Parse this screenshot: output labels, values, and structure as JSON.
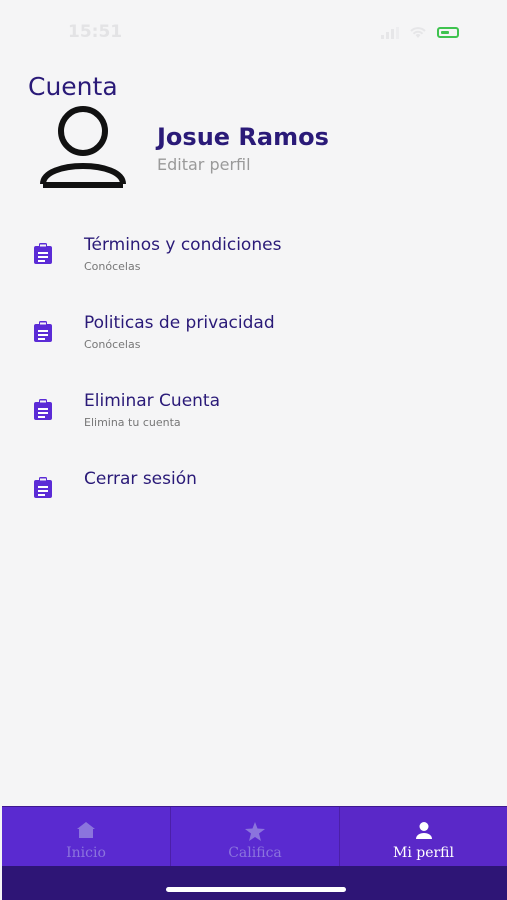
{
  "status_bar": {
    "time": "15:51"
  },
  "page": {
    "title": "Cuenta"
  },
  "profile": {
    "name": "Josue Ramos",
    "edit_label": "Editar perfil"
  },
  "menu": [
    {
      "title": "Términos y condiciones",
      "subtitle": "Conócelas",
      "icon": "clipboard-icon"
    },
    {
      "title": "Politicas de privacidad",
      "subtitle": "Conócelas",
      "icon": "clipboard-icon"
    },
    {
      "title": "Eliminar Cuenta",
      "subtitle": "Elimina tu cuenta",
      "icon": "clipboard-icon"
    },
    {
      "title": "Cerrar sesión",
      "subtitle": "",
      "icon": "clipboard-icon"
    }
  ],
  "bottom_nav": {
    "items": [
      {
        "label": "Inicio",
        "icon": "home-icon",
        "active": false
      },
      {
        "label": "Califica",
        "icon": "star-icon",
        "active": false
      },
      {
        "label": "Mi perfil",
        "icon": "person-icon",
        "active": true
      }
    ]
  },
  "colors": {
    "primary": "#5a28c8",
    "title": "#2a1a78",
    "icon": "#5b2bd6",
    "background": "#f5f5f6",
    "battery": "#3fc34f"
  }
}
